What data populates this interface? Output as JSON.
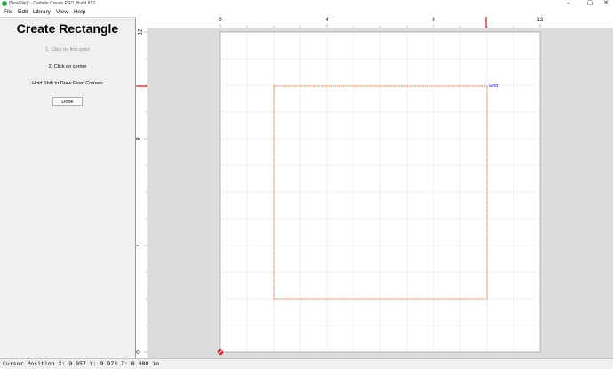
{
  "window": {
    "title": "[NewFile]* - Carbide Create PRO, Build 813",
    "controls": [
      "–",
      "▢",
      "✕"
    ]
  },
  "menu": [
    "File",
    "Edit",
    "Library",
    "View",
    "Help"
  ],
  "panel": {
    "title": "Create Rectangle",
    "step1": "1. Click on first point",
    "step2": "2. Click on corner",
    "hint": "Hold Shift to Draw From Corners",
    "done_label": "Done"
  },
  "ruler": {
    "top_labels": [
      "0",
      "4",
      "8",
      "12"
    ],
    "left_labels": [
      "12",
      "8",
      "4",
      "0"
    ]
  },
  "canvas": {
    "grid_label": "Grid",
    "grid_color": "#1a1adb",
    "rect_color": "#e0804a",
    "marker_color": "#cc1111",
    "origin_color": "#e02020"
  },
  "status": {
    "text": "Cursor Position X: 9.957 Y: 9.973 Z: 0.000 in"
  }
}
